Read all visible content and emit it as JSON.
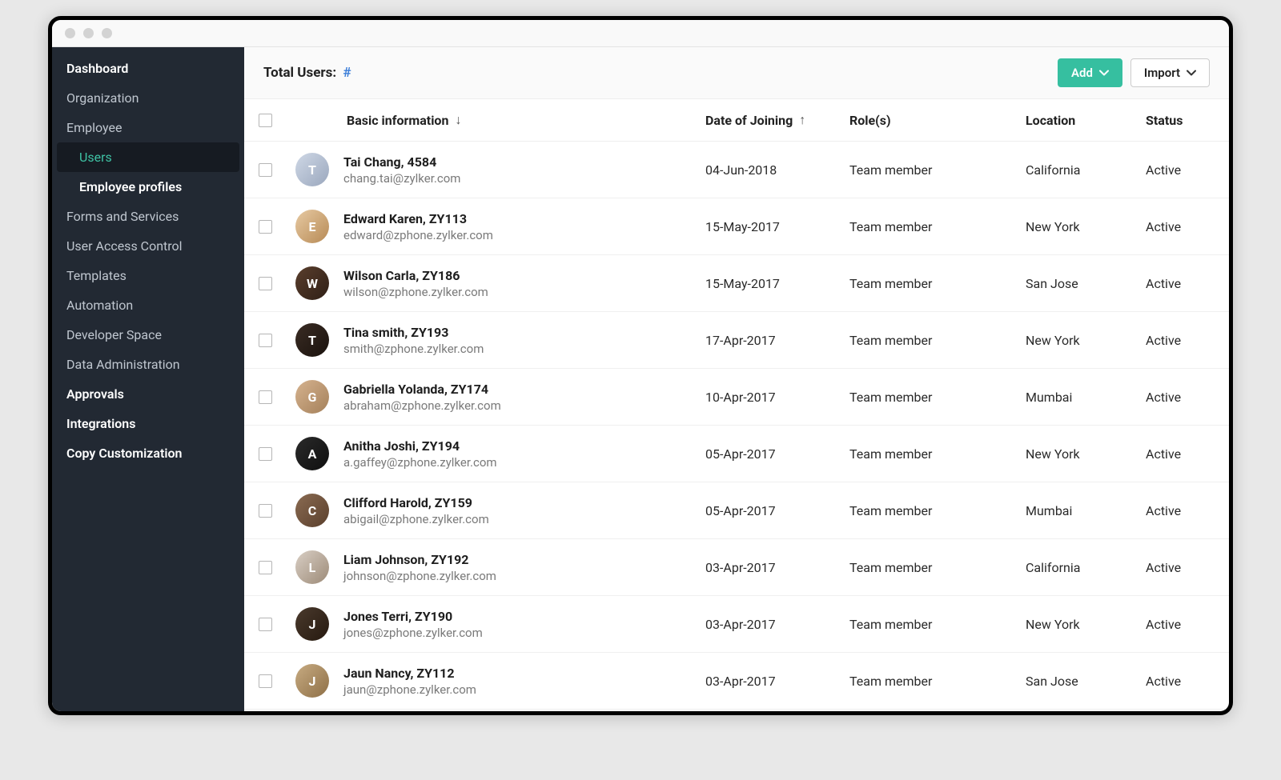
{
  "sidebar": {
    "items": [
      {
        "label": "Dashboard",
        "kind": "item bold"
      },
      {
        "label": "Organization",
        "kind": "item"
      },
      {
        "label": "Employee",
        "kind": "item"
      },
      {
        "label": "Users",
        "kind": "subitem active"
      },
      {
        "label": "Employee profiles",
        "kind": "subitem bold"
      },
      {
        "label": "Forms and Services",
        "kind": "item"
      },
      {
        "label": "User Access Control",
        "kind": "item"
      },
      {
        "label": "Templates",
        "kind": "item"
      },
      {
        "label": "Automation",
        "kind": "item"
      },
      {
        "label": "Developer Space",
        "kind": "item"
      },
      {
        "label": "Data Administration",
        "kind": "item"
      },
      {
        "label": "Approvals",
        "kind": "item bold"
      },
      {
        "label": "Integrations",
        "kind": "item bold"
      },
      {
        "label": "Copy Customization",
        "kind": "item bold"
      }
    ]
  },
  "toolbar": {
    "total_label": "Total Users:",
    "total_value": "#",
    "add_label": "Add",
    "import_label": "Import"
  },
  "columns": {
    "info": "Basic information",
    "info_arrow": "↓",
    "date": "Date of Joining",
    "date_arrow": "↑",
    "role": "Role(s)",
    "location": "Location",
    "status": "Status"
  },
  "users": [
    {
      "name": "Tai Chang, 4584",
      "email": "chang.tai@zylker.com",
      "date": "04-Jun-2018",
      "role": "Team member",
      "location": "California",
      "status": "Active",
      "avatar_bg": "linear-gradient(135deg,#cfd8e6,#9aa7bd)",
      "initial": "T"
    },
    {
      "name": "Edward Karen, ZY113",
      "email": "edward@zphone.zylker.com",
      "date": "15-May-2017",
      "role": "Team member",
      "location": "New York",
      "status": "Active",
      "avatar_bg": "linear-gradient(135deg,#e7caa3,#b78a55)",
      "initial": "E"
    },
    {
      "name": "Wilson Carla, ZY186",
      "email": "wilson@zphone.zylker.com",
      "date": "15-May-2017",
      "role": "Team member",
      "location": "San Jose",
      "status": "Active",
      "avatar_bg": "linear-gradient(135deg,#5a3e2d,#2f1f16)",
      "initial": "W"
    },
    {
      "name": "Tina smith, ZY193",
      "email": "smith@zphone.zylker.com",
      "date": "17-Apr-2017",
      "role": "Team member",
      "location": "New York",
      "status": "Active",
      "avatar_bg": "linear-gradient(135deg,#3a2c24,#1a120d)",
      "initial": "T"
    },
    {
      "name": "Gabriella Yolanda, ZY174",
      "email": "abraham@zphone.zylker.com",
      "date": "10-Apr-2017",
      "role": "Team member",
      "location": "Mumbai",
      "status": "Active",
      "avatar_bg": "linear-gradient(135deg,#d6b38f,#a4805a)",
      "initial": "G"
    },
    {
      "name": "Anitha Joshi, ZY194",
      "email": "a.gaffey@zphone.zylker.com",
      "date": "05-Apr-2017",
      "role": "Team member",
      "location": "New York",
      "status": "Active",
      "avatar_bg": "linear-gradient(135deg,#2a2a2a,#0f0f0f)",
      "initial": "A"
    },
    {
      "name": "Clifford Harold, ZY159",
      "email": "abigail@zphone.zylker.com",
      "date": "05-Apr-2017",
      "role": "Team member",
      "location": "Mumbai",
      "status": "Active",
      "avatar_bg": "linear-gradient(135deg,#8a6b52,#5a3f2c)",
      "initial": "C"
    },
    {
      "name": "Liam Johnson, ZY192",
      "email": "johnson@zphone.zylker.com",
      "date": "03-Apr-2017",
      "role": "Team member",
      "location": "California",
      "status": "Active",
      "avatar_bg": "linear-gradient(135deg,#d9cfc5,#9c8a77)",
      "initial": "L"
    },
    {
      "name": "Jones Terri, ZY190",
      "email": "jones@zphone.zylker.com",
      "date": "03-Apr-2017",
      "role": "Team member",
      "location": "New York",
      "status": "Active",
      "avatar_bg": "linear-gradient(135deg,#4a3a2d,#26190f)",
      "initial": "J"
    },
    {
      "name": "Jaun Nancy, ZY112",
      "email": "jaun@zphone.zylker.com",
      "date": "03-Apr-2017",
      "role": "Team member",
      "location": "San Jose",
      "status": "Active",
      "avatar_bg": "linear-gradient(135deg,#c7ab82,#8e6f46)",
      "initial": "J"
    }
  ]
}
